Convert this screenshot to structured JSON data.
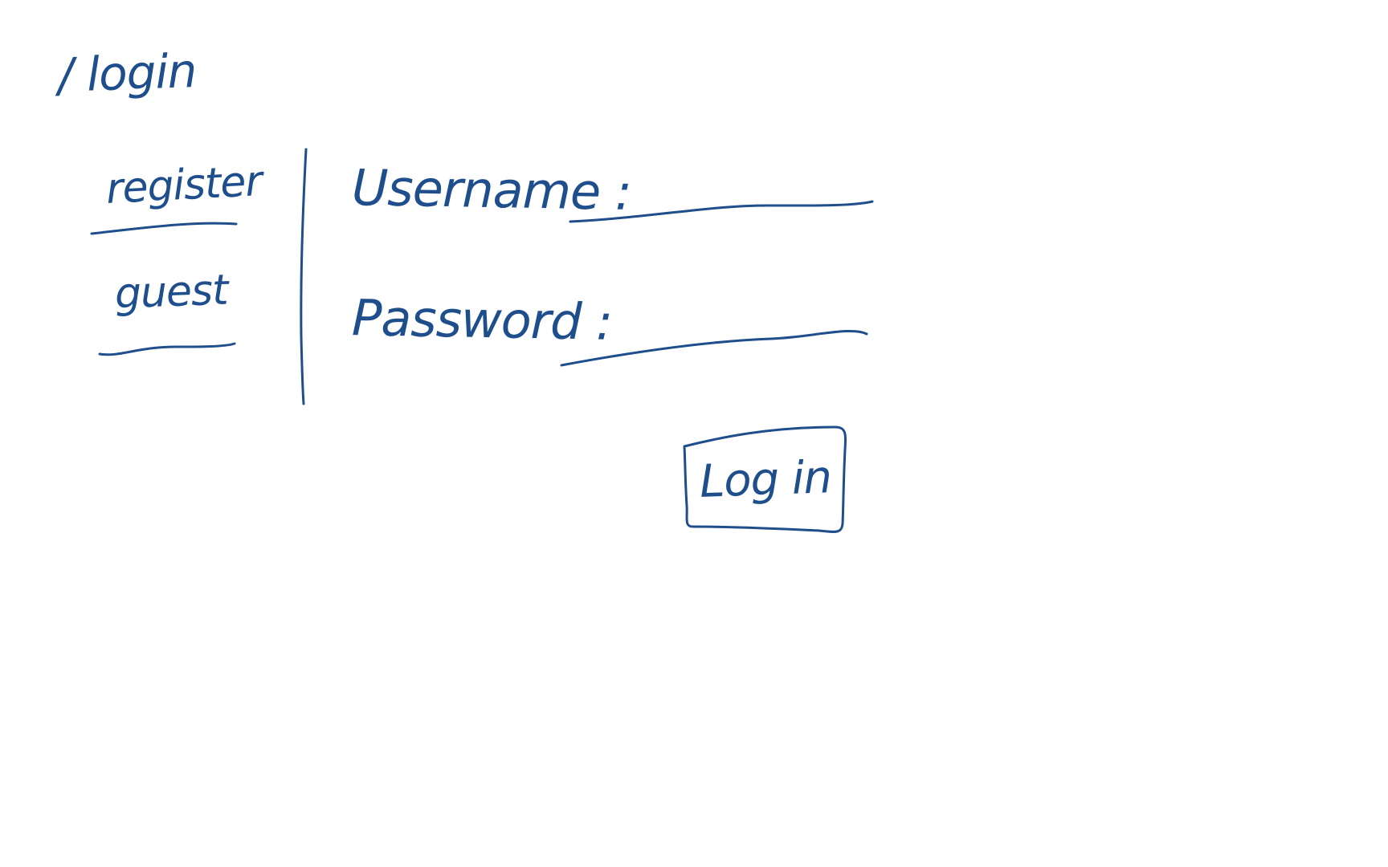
{
  "page": {
    "route": "/ login"
  },
  "sidebar": {
    "items": [
      {
        "label": "register"
      },
      {
        "label": "guest"
      }
    ]
  },
  "form": {
    "username_label": "Username :",
    "username_value": "",
    "password_label": "Password :",
    "password_value": "",
    "submit_label": "Log in"
  },
  "style": {
    "ink_color": "#1f4e8c",
    "background": "#ffffff"
  }
}
